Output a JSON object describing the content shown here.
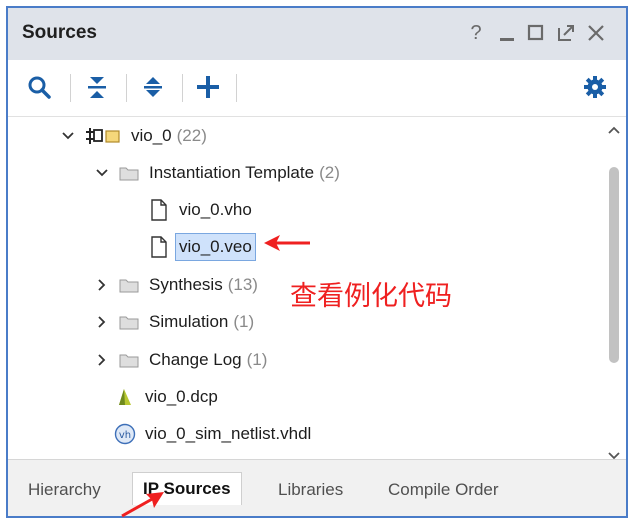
{
  "panel": {
    "title": "Sources",
    "help_label": "?",
    "buttons": [
      "minimize",
      "restore",
      "float",
      "close"
    ]
  },
  "toolbar": {
    "buttons": [
      "search",
      "collapse-all",
      "expand-all",
      "add",
      "settings"
    ]
  },
  "tree": {
    "root": {
      "label": "vio_0",
      "count": "(22)"
    },
    "instantiation": {
      "label": "Instantiation Template",
      "count": "(2)"
    },
    "vho": {
      "label": "vio_0.vho"
    },
    "veo": {
      "label": "vio_0.veo"
    },
    "synthesis": {
      "label": "Synthesis",
      "count": "(13)"
    },
    "simulation": {
      "label": "Simulation",
      "count": "(1)"
    },
    "changelog": {
      "label": "Change Log",
      "count": "(1)"
    },
    "dcp": {
      "label": "vio_0.dcp"
    },
    "vhdl": {
      "label": "vio_0_sim_netlist.vhdl"
    },
    "partial": {
      "label": "vio_0_sim_netlist"
    }
  },
  "tabs": [
    {
      "label": "Hierarchy",
      "active": false
    },
    {
      "label": "IP Sources",
      "active": true
    },
    {
      "label": "Libraries",
      "active": false
    },
    {
      "label": "Compile Order",
      "active": false
    }
  ],
  "annotation": {
    "text": "查看例化代码",
    "color": "#ef2020"
  },
  "colors": {
    "accent": "#1a5ea6",
    "selection": "#cfe2fb",
    "annotation": "#ef2020",
    "frame": "#4a7cc8"
  }
}
